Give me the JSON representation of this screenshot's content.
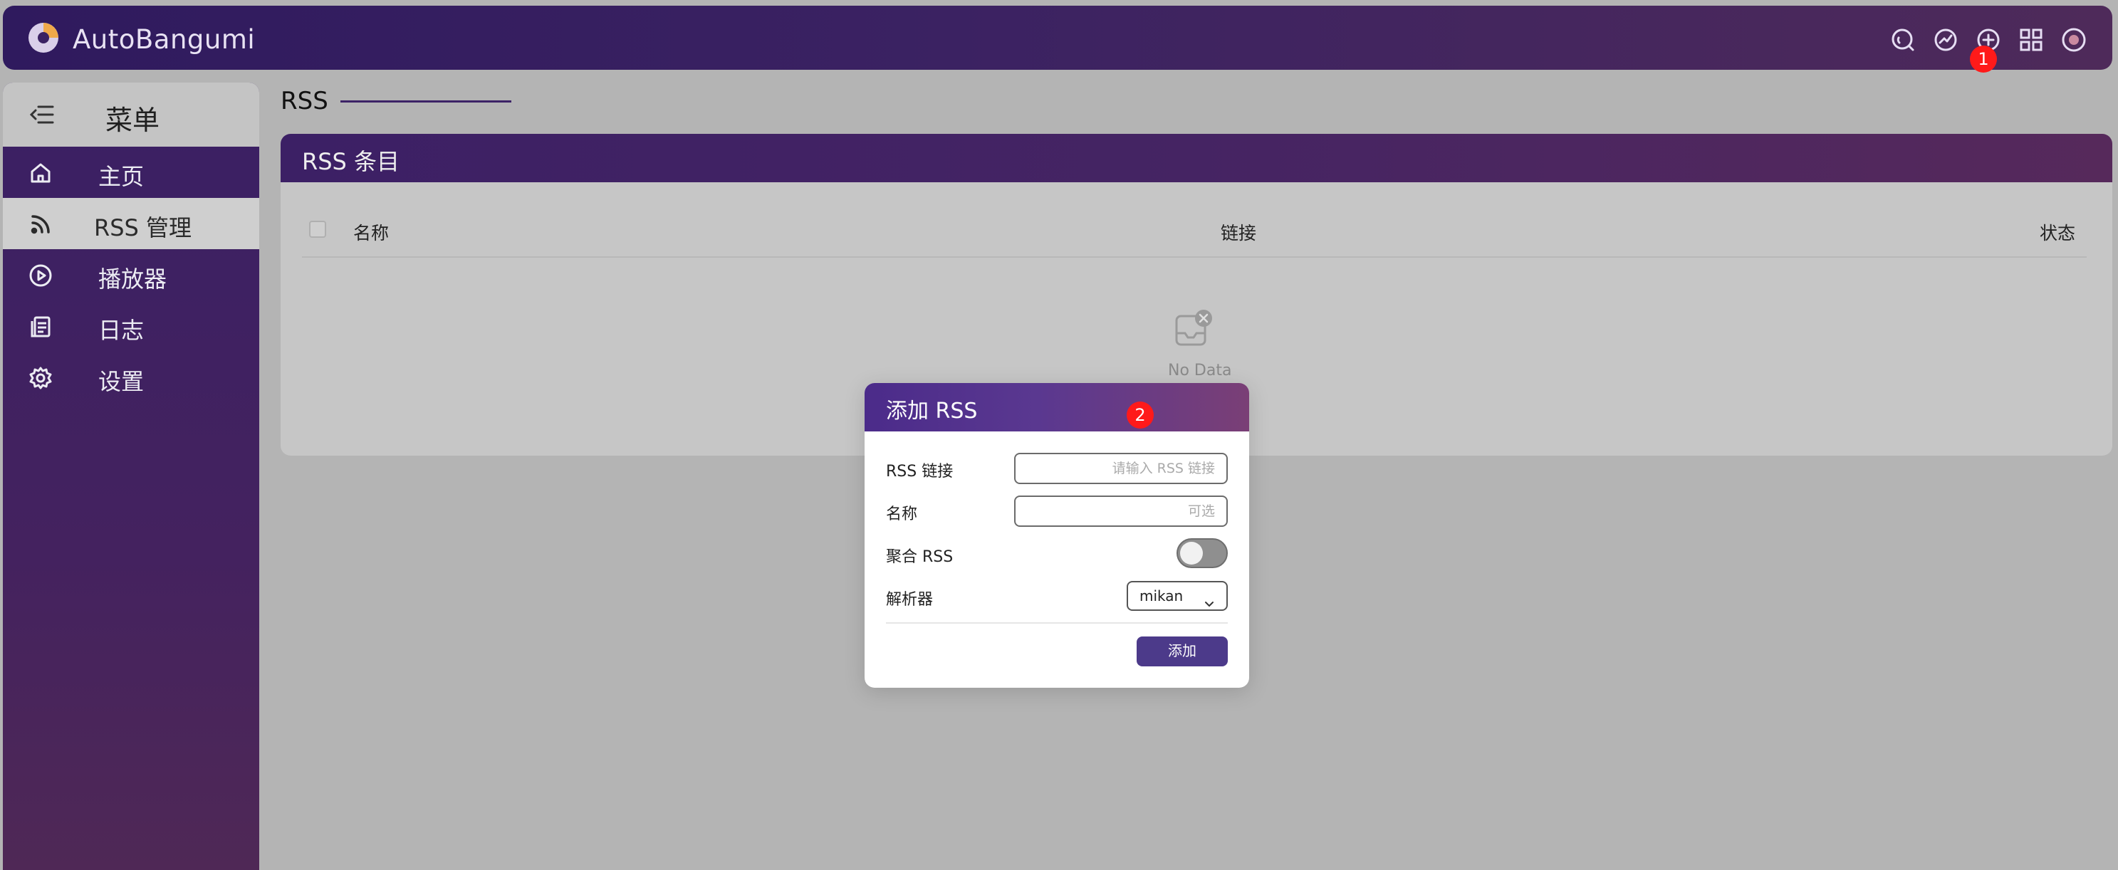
{
  "app": {
    "brand": "AutoBangumi",
    "top_icons": [
      "search-icon",
      "compass-icon",
      "plus-circle-icon",
      "grid-icon",
      "record-icon"
    ],
    "badges": {
      "topbar_badge": "1",
      "modal_badge": "2"
    }
  },
  "sidebar": {
    "menu_title": "菜单",
    "items": [
      {
        "label": "主页",
        "icon": "home-icon",
        "active": false
      },
      {
        "label": "RSS 管理",
        "icon": "rss-icon",
        "active": true
      },
      {
        "label": "播放器",
        "icon": "play-icon",
        "active": false
      },
      {
        "label": "日志",
        "icon": "log-icon",
        "active": false
      },
      {
        "label": "设置",
        "icon": "gear-icon",
        "active": false
      }
    ]
  },
  "main": {
    "page_title": "RSS",
    "card_title": "RSS 条目",
    "table_headers": {
      "name": "名称",
      "link": "链接",
      "status": "状态"
    },
    "empty_text": "No Data"
  },
  "modal": {
    "title": "添加 RSS",
    "rss_link_label": "RSS 链接",
    "rss_link_placeholder": "请输入 RSS 链接",
    "name_label": "名称",
    "name_placeholder": "可选",
    "aggregate_label": "聚合 RSS",
    "aggregate_enabled": false,
    "parser_label": "解析器",
    "parser_value": "mikan",
    "add_button": "添加"
  },
  "colors": {
    "primary": "#3b2262",
    "accent": "#4c3a8a",
    "badge": "#ff1a1a"
  }
}
